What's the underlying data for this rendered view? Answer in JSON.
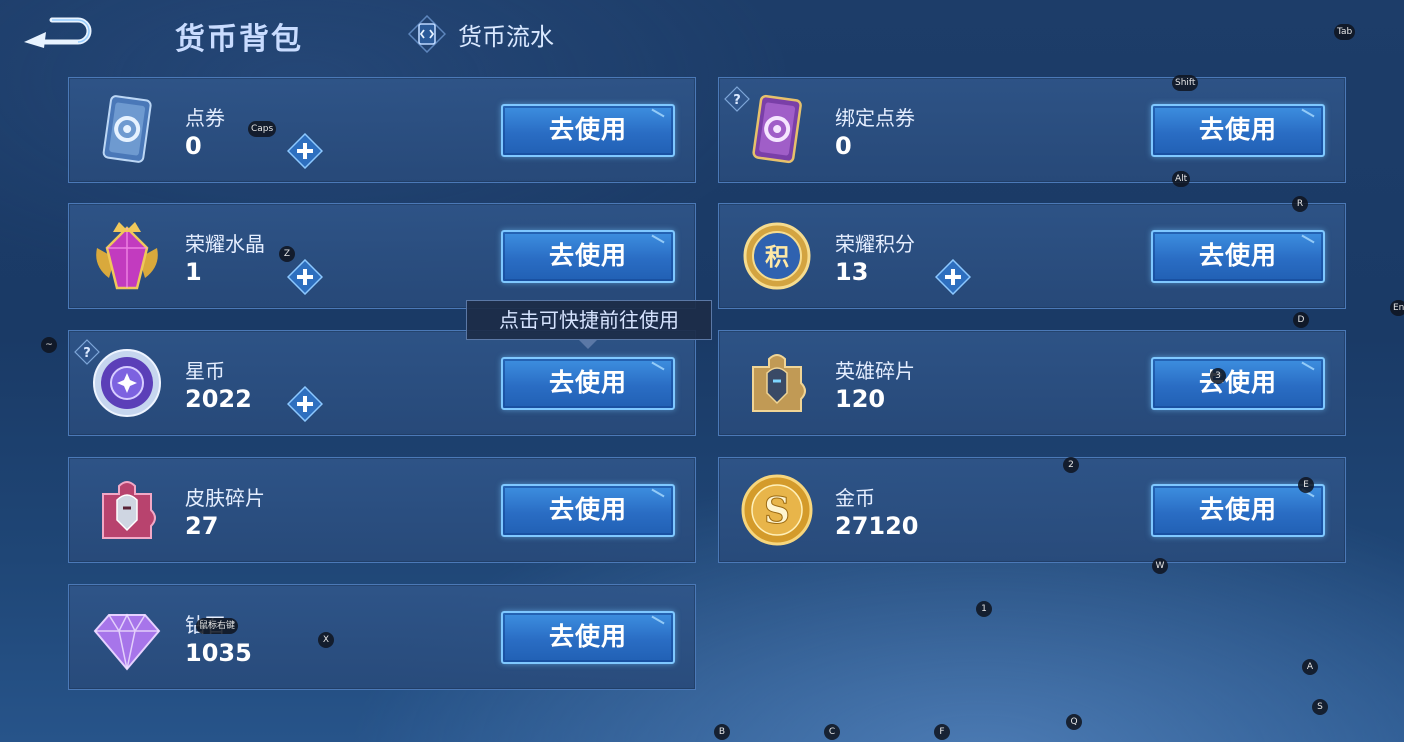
{
  "header": {
    "back_icon": "back-arrow-icon",
    "title": "货币背包",
    "history_tab": "货币流水",
    "history_icon": "coin-flow-icon"
  },
  "currencies": [
    {
      "name": "点券",
      "amount": "0",
      "icon": "voucher-card-icon",
      "has_plus": true,
      "has_help": false,
      "button": "去使用"
    },
    {
      "name": "绑定点券",
      "amount": "0",
      "icon": "bound-voucher-card-icon",
      "has_plus": false,
      "has_help": true,
      "button": "去使用"
    },
    {
      "name": "荣耀水晶",
      "amount": "1",
      "icon": "glory-crystal-icon",
      "has_plus": true,
      "has_help": false,
      "button": "去使用"
    },
    {
      "name": "荣耀积分",
      "amount": "13",
      "icon": "glory-points-icon",
      "has_plus": true,
      "has_help": false,
      "button": "去使用"
    },
    {
      "name": "星币",
      "amount": "2022",
      "icon": "star-coin-icon",
      "has_plus": true,
      "has_help": true,
      "button": "去使用"
    },
    {
      "name": "英雄碎片",
      "amount": "120",
      "icon": "hero-fragment-icon",
      "has_plus": false,
      "has_help": false,
      "button": "去使用"
    },
    {
      "name": "皮肤碎片",
      "amount": "27",
      "icon": "skin-fragment-icon",
      "has_plus": false,
      "has_help": false,
      "button": "去使用"
    },
    {
      "name": "金币",
      "amount": "27120",
      "icon": "gold-coin-icon",
      "has_plus": false,
      "has_help": false,
      "button": "去使用"
    },
    {
      "name": "钻石",
      "amount": "1035",
      "icon": "diamond-icon",
      "has_plus": false,
      "has_help": false,
      "button": "去使用"
    }
  ],
  "tooltip": "点击可快捷前往使用",
  "key_hints": [
    "Tab",
    "Shift",
    "Caps",
    "Alt",
    "R",
    "Z",
    "D",
    "En",
    "~",
    "3",
    "2",
    "E",
    "W",
    "1",
    "X",
    "鼠标右键",
    "A",
    "S",
    "B",
    "C",
    "F",
    "Q"
  ],
  "colors": {
    "card_border": "#4b79b7",
    "button_fill": "#2a6dc4",
    "button_border": "#7fc8ff",
    "background": "#1d3d69"
  }
}
